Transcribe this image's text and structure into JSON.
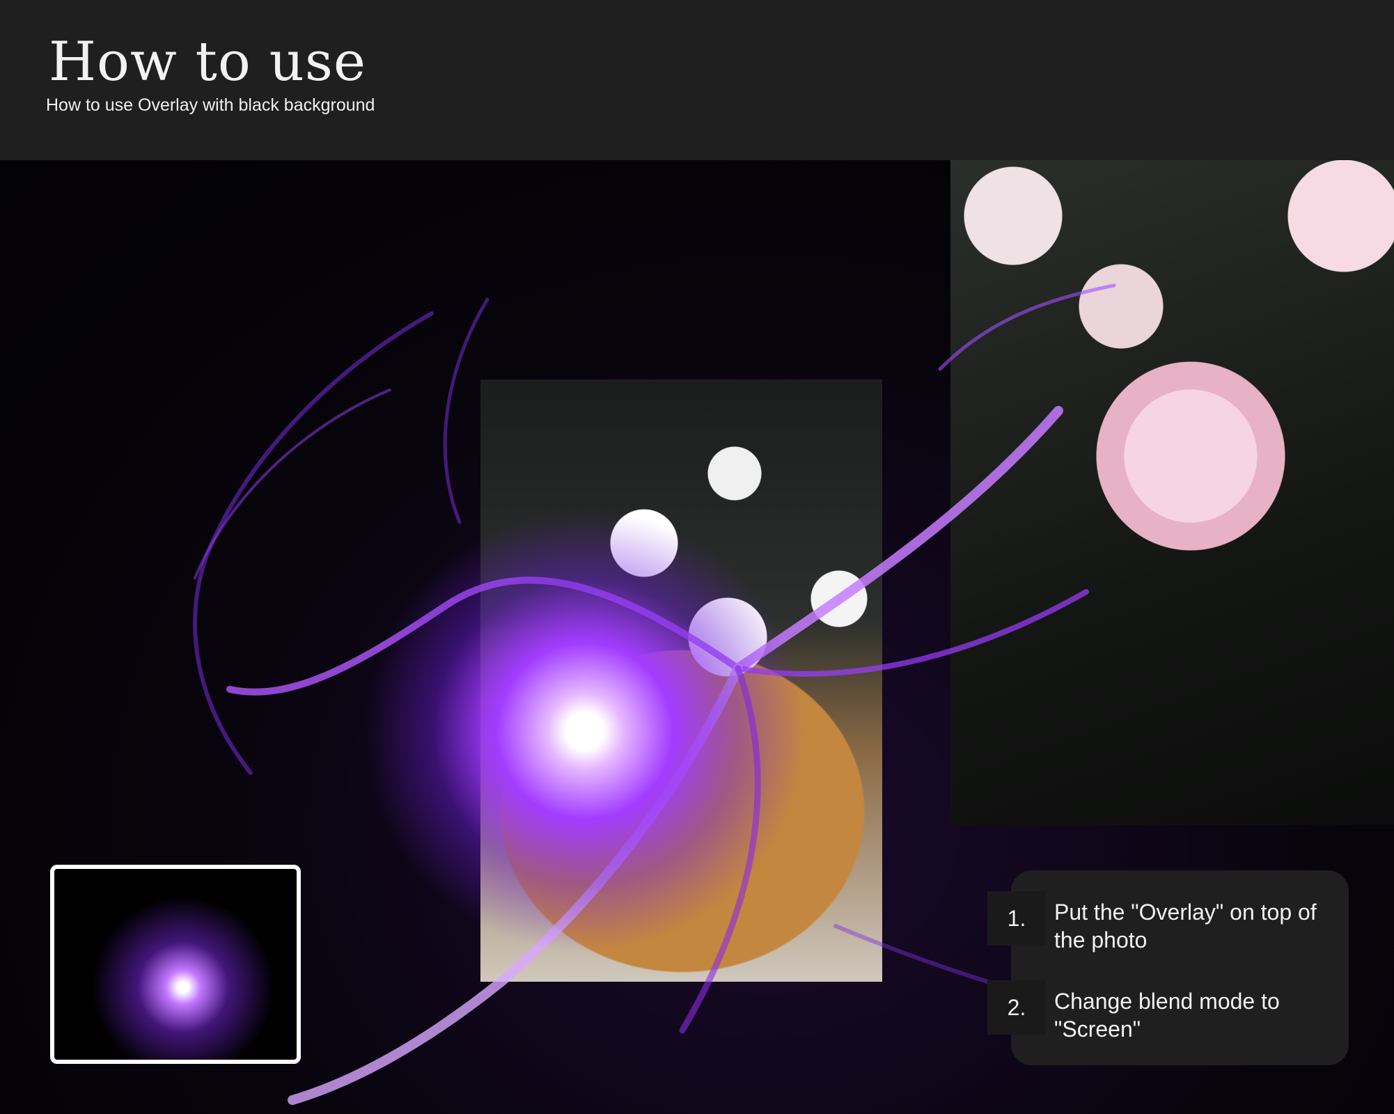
{
  "header": {
    "title": "How to use",
    "subtitle": "How to use Overlay with black background"
  },
  "steps": [
    {
      "number": "1.",
      "text": "Put the \"Overlay\" on top of the photo"
    },
    {
      "number": "2.",
      "text": "Change blend mode to \"Screen\""
    }
  ],
  "colors": {
    "header_bg": "#1f1f1f",
    "overlay_glow": "#a23cff",
    "page_bg": "#050407"
  }
}
